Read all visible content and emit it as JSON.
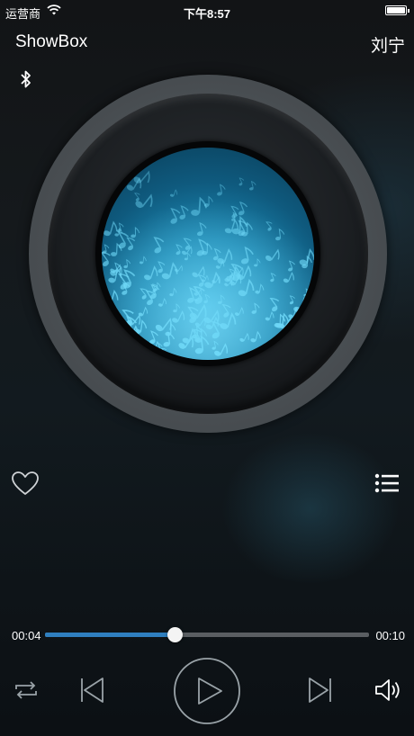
{
  "status_bar": {
    "carrier": "运营商",
    "time": "下午8:57",
    "wifi_icon": "wifi-icon",
    "battery_icon": "battery-icon",
    "battery_level": 1.0
  },
  "header": {
    "app_title": "ShowBox",
    "user_name": "刘宁",
    "bluetooth_icon": "bluetooth-icon"
  },
  "album_art": {
    "description_icon": "vinyl-disc-music-notes"
  },
  "actions": {
    "favorite_icon": "heart-icon",
    "playlist_icon": "list-icon"
  },
  "player": {
    "current_time": "00:04",
    "total_time": "00:10",
    "progress": 0.4,
    "repeat_icon": "repeat-icon",
    "previous_icon": "skip-previous-icon",
    "play_icon": "play-icon",
    "next_icon": "skip-next-icon",
    "volume_icon": "volume-icon"
  },
  "colors": {
    "accent": "#2f7fbf",
    "disc_blue": "#1c8ab5",
    "note_cyan": "#5fd3f5"
  }
}
